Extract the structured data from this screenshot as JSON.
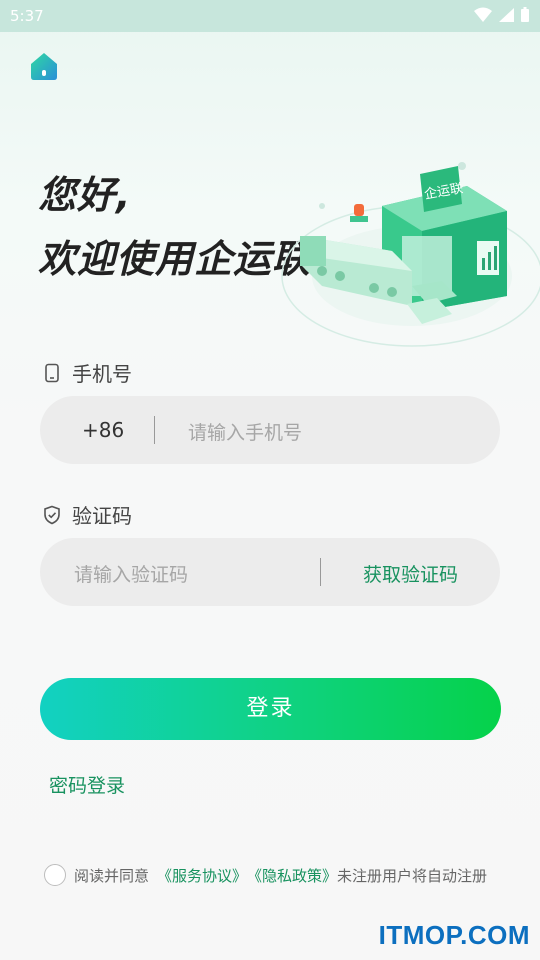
{
  "status_bar": {
    "time": "5:37"
  },
  "greeting": {
    "line1": "您好,",
    "line2": "欢迎使用企运联"
  },
  "illustration": {
    "sign_text": "企运联"
  },
  "phone": {
    "label": "手机号",
    "prefix": "+86",
    "placeholder": "请输入手机号"
  },
  "code": {
    "label": "验证码",
    "placeholder": "请输入验证码",
    "get_code": "获取验证码"
  },
  "login_button": "登录",
  "password_login": "密码登录",
  "agreement": {
    "prefix": "阅读并同意",
    "service": "《服务协议》",
    "privacy": "《隐私政策》",
    "suffix": "未注册用户将自动注册"
  },
  "watermark": "ITMOP.COM",
  "colors": {
    "accent": "#18925f",
    "button_start": "#12d1c2",
    "button_end": "#05d24a"
  }
}
